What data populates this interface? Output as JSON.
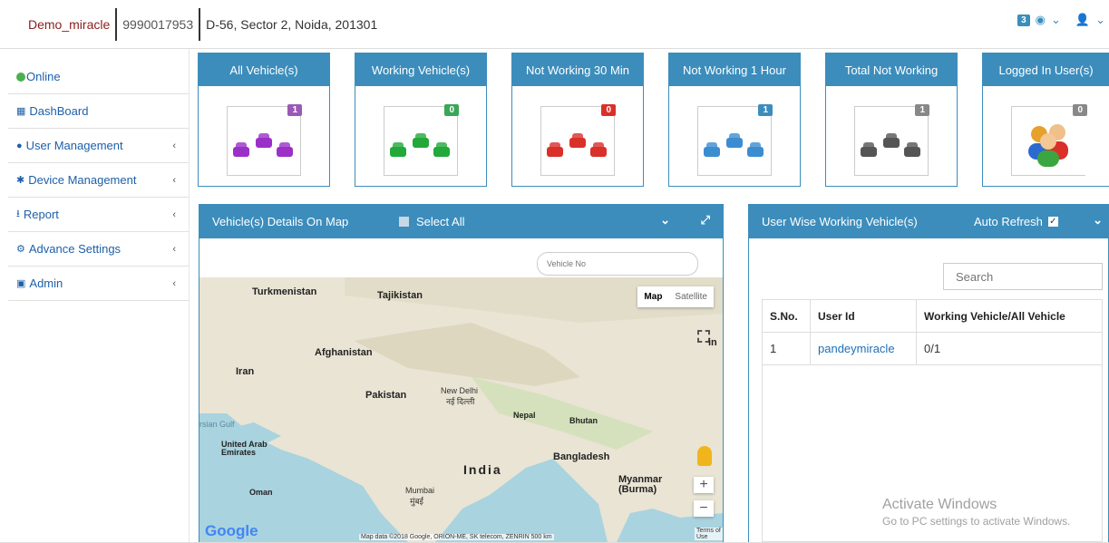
{
  "header": {
    "company_name": "Demo_miracle",
    "phone": "9990017953",
    "address": "D-56, Sector 2, Noida, 201301",
    "notification_count": "3"
  },
  "sidebar": {
    "items": [
      {
        "label": "Online",
        "icon": "online-dot-icon"
      },
      {
        "label": "DashBoard",
        "icon": "table-icon"
      },
      {
        "label": "User Management",
        "icon": "user-icon"
      },
      {
        "label": "Device Management",
        "icon": "asterisk-icon"
      },
      {
        "label": "Report",
        "icon": "download-icon"
      },
      {
        "label": "Advance Settings",
        "icon": "gear-icon"
      },
      {
        "label": "Admin",
        "icon": "briefcase-icon"
      }
    ]
  },
  "cards": [
    {
      "title": "All Vehicle(s)",
      "count": "1",
      "color": "#9b30c8",
      "badge": "#9b59b6"
    },
    {
      "title": "Working Vehicle(s)",
      "count": "0",
      "color": "#22a93a",
      "badge": "#3aa657"
    },
    {
      "title": "Not Working 30 Min",
      "count": "0",
      "color": "#d9302a",
      "badge": "#d9302a"
    },
    {
      "title": "Not Working 1 Hour",
      "count": "1",
      "color": "#3c8dd0",
      "badge": "#3c8dbc"
    },
    {
      "title": "Total Not Working",
      "count": "1",
      "color": "#555555",
      "badge": "#888888"
    },
    {
      "title": "Logged In User(s)",
      "count": "0",
      "color": "#e07a2c",
      "badge": "#888888"
    }
  ],
  "map_panel": {
    "title": "Vehicle(s) Details On Map",
    "select_all": "Select All",
    "vehicle_placeholder": "Vehicle No",
    "map_toggle": [
      "Map",
      "Satellite"
    ],
    "labels": {
      "turkmenistan": "Turkmenistan",
      "tajikistan": "Tajikistan",
      "afghanistan": "Afghanistan",
      "iran": "Iran",
      "pakistan": "Pakistan",
      "new_delhi": "New Delhi",
      "new_delhi_hi": "नई दिल्ली",
      "nepal": "Nepal",
      "bhutan": "Bhutan",
      "persian_gulf": "rsian Gulf",
      "uae": "United Arab Emirates",
      "bangladesh": "Bangladesh",
      "india": "India",
      "myanmar": "Myanmar (Burma)",
      "oman": "Oman",
      "mumbai": "Mumbai",
      "mumbai_hi": "मुंबई",
      "chin": "in",
      "google": "Google",
      "attribution": "Map data ©2018 Google, ORION-ME, SK telecom, ZENRIN   500 km",
      "terms": "Terms of Use"
    }
  },
  "user_panel": {
    "title": "User Wise Working Vehicle(s)",
    "auto_refresh": "Auto Refresh",
    "search_placeholder": "Search",
    "columns": [
      "S.No.",
      "User Id",
      "Working Vehicle/All Vehicle"
    ],
    "rows": [
      {
        "sno": "1",
        "user": "pandeymiracle",
        "ratio": "0/1"
      }
    ]
  },
  "watermark": {
    "line1": "Activate Windows",
    "line2": "Go to PC settings to activate Windows."
  }
}
